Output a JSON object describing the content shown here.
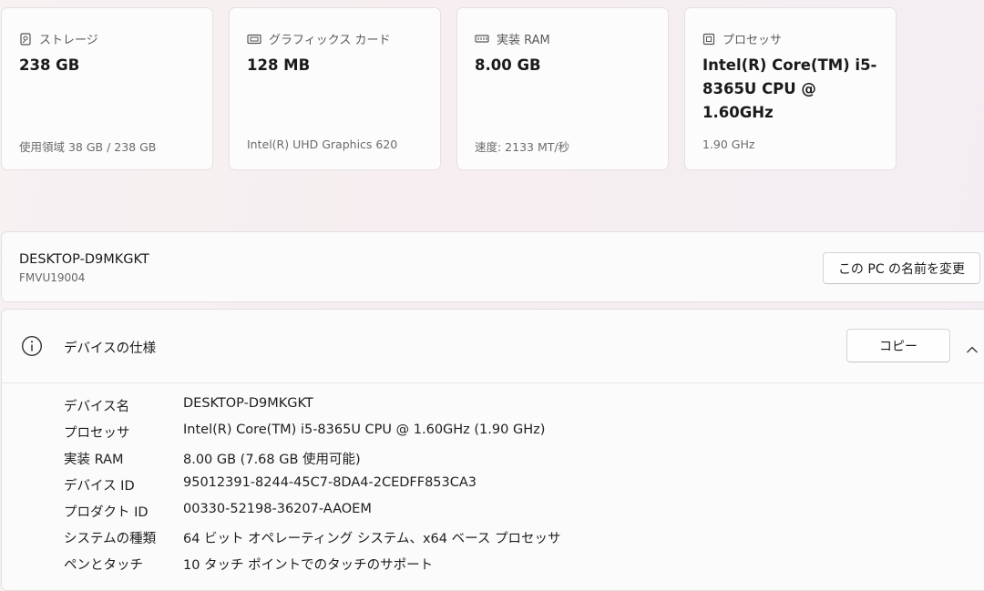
{
  "cards": [
    {
      "title": "ストレージ",
      "icon": "storage-icon",
      "value": "238 GB",
      "sub": "使用領域 38 GB / 238 GB"
    },
    {
      "title": "グラフィックス カード",
      "icon": "graphics-card-icon",
      "value": "128 MB",
      "sub": "Intel(R) UHD Graphics 620"
    },
    {
      "title": "実装 RAM",
      "icon": "ram-icon",
      "value": "8.00 GB",
      "sub": "速度: 2133 MT/秒"
    },
    {
      "title": "プロセッサ",
      "icon": "processor-icon",
      "value": "Intel(R) Core(TM) i5-8365U CPU @ 1.60GHz",
      "sub": "1.90 GHz"
    }
  ],
  "pc": {
    "name": "DESKTOP-D9MKGKT",
    "model": "FMVU19004",
    "rename_label": "この PC の名前を変更"
  },
  "spec": {
    "title": "デバイスの仕様",
    "copy_label": "コピー",
    "rows": [
      {
        "label": "デバイス名",
        "value": "DESKTOP-D9MKGKT"
      },
      {
        "label": "プロセッサ",
        "value": "Intel(R) Core(TM) i5-8365U CPU @ 1.60GHz (1.90 GHz)"
      },
      {
        "label": "実装 RAM",
        "value": "8.00 GB (7.68 GB 使用可能)"
      },
      {
        "label": "デバイス ID",
        "value": "95012391-8244-45C7-8DA4-2CEDFF853CA3"
      },
      {
        "label": "プロダクト ID",
        "value": "00330-52198-36207-AAOEM"
      },
      {
        "label": "システムの種類",
        "value": "64 ビット オペレーティング システム、x64 ベース プロセッサ"
      },
      {
        "label": "ペンとタッチ",
        "value": "10 タッチ ポイントでのタッチのサポート"
      }
    ]
  }
}
